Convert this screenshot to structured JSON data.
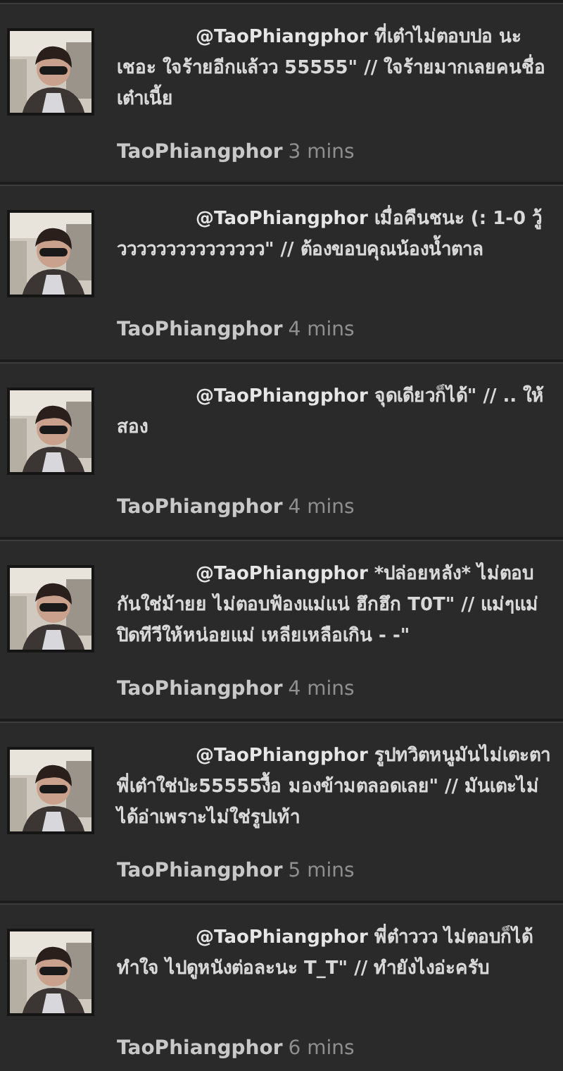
{
  "tweets": [
    {
      "mention": "@TaoPhiangphor",
      "text": "ที่เต๋าไม่ตอบปอ นะ เชอะ ใจร้ายอีกแล้วว 55555\" // ใจร้ายมากเลยคนชื่อเต๋าเนี้ย",
      "author": "TaoPhiangphor",
      "time": "3 mins"
    },
    {
      "mention": "@TaoPhiangphor",
      "text": "เมื่อคืนชนะ (: 1-0 วู้ววววววววววววววว\" // ต้องขอบคุณน้องน้ำตาล",
      "author": "TaoPhiangphor",
      "time": "4 mins"
    },
    {
      "mention": "@TaoPhiangphor",
      "text": "จุดเดียวก็ได้\" // .. ให้สอง",
      "author": "TaoPhiangphor",
      "time": "4 mins"
    },
    {
      "mention": "@TaoPhiangphor",
      "text": "*ปล่อยหลัง* ไม่ตอบกันใช่ม้ายย ไม่ตอบฟ้องแม่แน่ ฮึกฮึก T0T\" // แม่ๆแม่ปิดทีวีให้หน่อยแม่ เหลียเหลือเกิน - -\"",
      "author": "TaoPhiangphor",
      "time": "4 mins"
    },
    {
      "mention": "@TaoPhiangphor",
      "text": "รูปทวิตหนูมันไม่เตะตาพี่เต๋าใช่ป่ะ55555งื้อ มองข้ามตลอดเลย\" // มันเตะไม่ได้อ่าเพราะไม่ใช่รูปเท้า",
      "author": "TaoPhiangphor",
      "time": "5 mins"
    },
    {
      "mention": "@TaoPhiangphor",
      "text": "พี่ต๋าววว ไม่ตอบก็ได้ ทำใจ ไปดูหนังต่อละนะ T_T\" // ทำยังไงอ่ะครับ",
      "author": "TaoPhiangphor",
      "time": "6 mins"
    }
  ]
}
